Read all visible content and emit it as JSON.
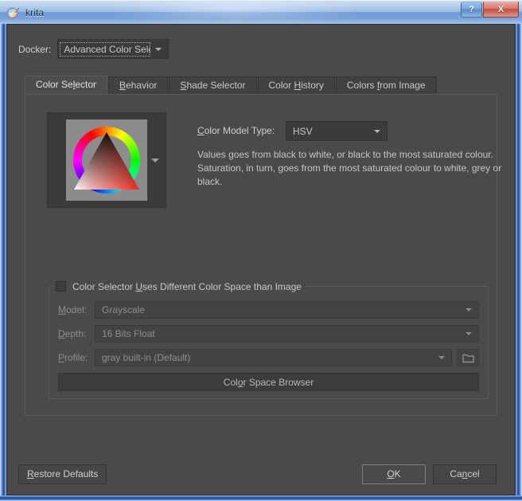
{
  "window": {
    "title": "krita",
    "app_icon": "krita-logo-icon",
    "help_button": "?",
    "close_button": "X"
  },
  "docker": {
    "label": "Docker:",
    "selected": "Advanced Color Selector"
  },
  "tabs": [
    {
      "label": "Color Se",
      "accel": "l",
      "rest": "ector",
      "active": true
    },
    {
      "label": "",
      "accel": "B",
      "rest": "ehavior",
      "active": false
    },
    {
      "label": "",
      "accel": "S",
      "rest": "hade Selector",
      "active": false
    },
    {
      "label": "Color ",
      "accel": "H",
      "rest": "istory",
      "active": false
    },
    {
      "label": "Colors ",
      "accel": "f",
      "rest": "rom Image",
      "active": false
    }
  ],
  "color_selector": {
    "preview_name": "HSV color wheel with value/saturation triangle",
    "color_model_type_label_pre": "",
    "color_model_type_label_accel": "C",
    "color_model_type_label_rest": "olor Model Type:",
    "color_model_type_value": "HSV",
    "description": "Values goes from black to white, or black to the most saturated colour. Saturation, in turn, goes from the most saturated colour to white, grey or black."
  },
  "color_space_group": {
    "checkbox_checked": false,
    "title_pre": "Color Selector ",
    "title_accel": "U",
    "title_rest": "ses Different Color Space than Image",
    "model_label_accel": "M",
    "model_label_rest": "odel:",
    "model_value": "Grayscale",
    "depth_label_accel": "D",
    "depth_label_rest": "epth:",
    "depth_value": "16 Bits Float",
    "profile_label_accel": "P",
    "profile_label_rest": "rofile:",
    "profile_value": "gray built-in (Default)",
    "browse_icon": "folder-icon",
    "browser_button_pre": "Col",
    "browser_button_accel": "o",
    "browser_button_rest": "r Space Browser"
  },
  "footer": {
    "restore_pre": "",
    "restore_accel": "R",
    "restore_rest": "estore Defaults",
    "ok_pre": "",
    "ok_accel": "O",
    "ok_rest": "K",
    "cancel_pre": "Ca",
    "cancel_accel": "n",
    "cancel_rest": "cel"
  },
  "colors": {
    "dialog_background": "#4a4a4a",
    "panel_dark": "#3b3b3b",
    "text": "#c9c9c9",
    "disabled_text": "#8e8e8e",
    "titlebar_text": "#13344f",
    "close_button": "#c04e40"
  }
}
